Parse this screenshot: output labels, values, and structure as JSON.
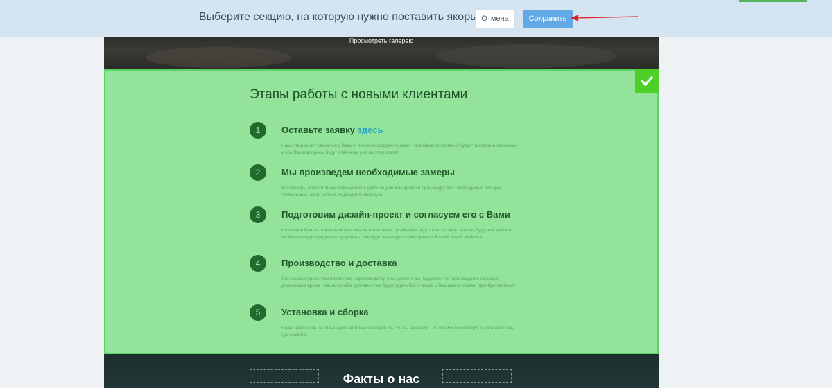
{
  "toolbar": {
    "prompt": "Выберите секцию, на которую нужно поставить якорь",
    "cancel_label": "Отмена",
    "save_label": "Сохранить"
  },
  "gallery": {
    "link_label": "Просмотреть галерею"
  },
  "section": {
    "title": "Этапы работы с новыми клиентами",
    "steps": [
      {
        "num": "1",
        "title": "Оставьте заявку ",
        "link": "здесь",
        "desc": "Наш специалист свяжется с Вами и поможет оформить заказ - все Ваши пожелания будут тщательно записаны и все Ваши вопросы будут отвечены уже на этом этапе!"
      },
      {
        "num": "2",
        "title": "Мы произведем необходимые замеры",
        "desc": "Менеджеры посетят Ваше помещение в удобное для Вас время и произведут все необходимые замеры - чтобы Ваша новая мебель подходила идеально."
      },
      {
        "num": "3",
        "title": "Подготовим дизайн-проект и согласуем его с Вами",
        "desc": "На основе Ваших пожеланий и размеров помещения дизайнеры подготовят полную модель будущей мебели, чтобы наглядно продемонстрировать, как будет выглядеть помещение с Вашей новой мебелью."
      },
      {
        "num": "4",
        "title": "Производство и доставка",
        "desc": "Согласовав проект мы приступим к производству, и не успеете вы подумать что производство занимает длительное время - наша служба доставки уже будет ждать Вас у входа с Вашими готовыми приобретениями!"
      },
      {
        "num": "5",
        "title": "Установка и сборка",
        "desc": "Наши работники не только доставят Вам на порог то, что вы заказали - но и сами все соберут и установят так, где скажете."
      }
    ]
  },
  "facts": {
    "title": "Факты о нас"
  },
  "colors": {
    "toolbar_bg": "#d5e4f1",
    "save_button": "#63a9e6",
    "selected_section": "#94e39a",
    "check_badge": "#4fcf2a",
    "step_circle": "#216c2d",
    "arrow": "#e02020"
  },
  "icons": {
    "badge": "checkmark-icon",
    "annotation": "red-arrow-icon"
  }
}
